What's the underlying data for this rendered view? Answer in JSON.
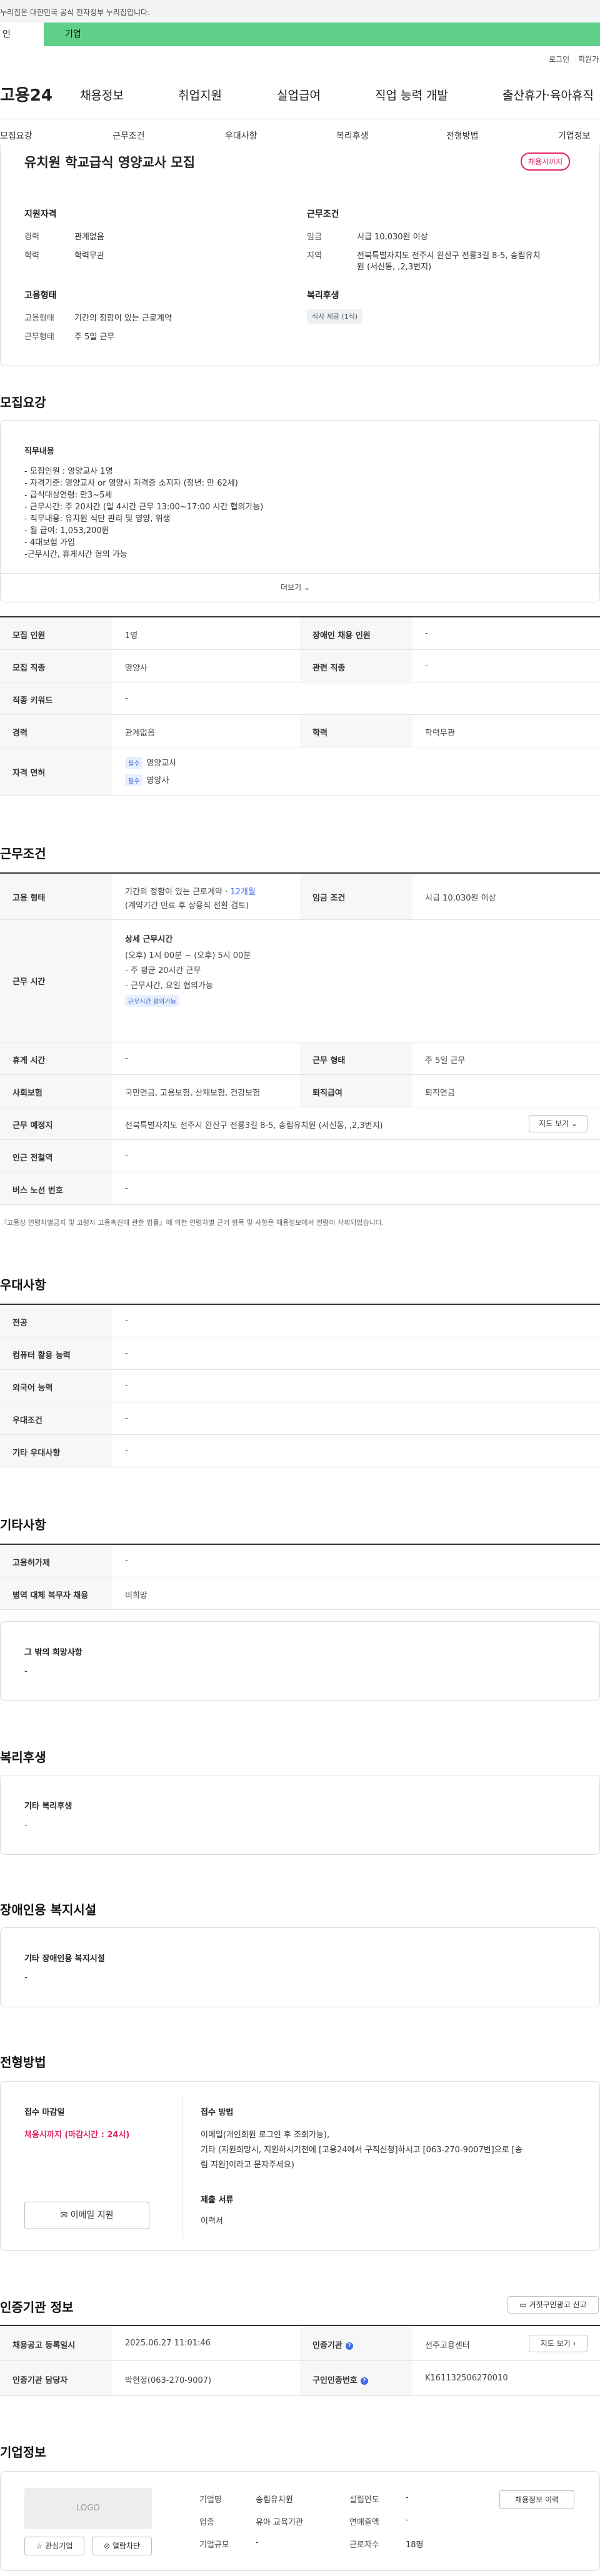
{
  "gov_notice": "누리집은 대한민국 공식 전자정부 누리집입니다.",
  "top_tabs": {
    "active": "인",
    "second": "기업"
  },
  "util": {
    "login": "로그인",
    "join": "회원가"
  },
  "logo": "고용24",
  "gnb": [
    "채용정보",
    "취업지원",
    "실업급여",
    "직업 능력 개발",
    "출산휴가·육아휴직"
  ],
  "subnav": [
    "모집요강",
    "근무조건",
    "우대사항",
    "복리후생",
    "전형방법",
    "기업정보"
  ],
  "header": {
    "title": "유치원 학교급식 영양교사 모집",
    "badge": "채용시까지",
    "qual_title": "지원자격",
    "career_label": "경력",
    "career_value": "관계없음",
    "edu_label": "학력",
    "edu_value": "학력무관",
    "cond_title": "근무조건",
    "wage_label": "임금",
    "wage_value": "시급 10,030원 이상",
    "region_label": "지역",
    "region_value1": "전북특별자치도 전주시 완산구 전룡3길 8-5, 송림유치",
    "region_value2": "원 (서신동, ,2,3번지)",
    "emp_title": "고용형태",
    "emp_label": "고용형태",
    "emp_value": "기간의 정함이 있는 근로계약",
    "worktype_label": "근무형태",
    "worktype_value": "주 5일 근무",
    "welfare_title": "복리후생",
    "welfare_chip": "식사 제공 (1식)"
  },
  "recruit": {
    "section_title": "모집요강",
    "duty_title": "직무내용",
    "duty_lines": [
      "- 모집인원 : 영양교사 1명",
      "- 자격기준: 영양교사 or 영양사 자격증 소지자 (정년: 만 62세)",
      "- 급식대상연령: 만3~5세",
      "- 근무시간: 주 20시간 (일 4시간 근무 13:00~17:00  시간 협의가능)",
      "- 직무내용: 유치원 식단 관리 및 영양, 위생",
      "- 월 급여: 1,053,200원",
      "- 4대보험 가입",
      "-근무시간, 휴게시간 협의 가능"
    ],
    "more": "더보기",
    "rows": {
      "count_label": "모집 인원",
      "count_value": "1명",
      "disabled_label": "장애인 채용 인원",
      "disabled_value": "-",
      "job_label": "모집 직종",
      "job_value": "영양사",
      "related_label": "관련 직종",
      "related_value": "-",
      "keyword_label": "직종 키워드",
      "keyword_value": "-",
      "career_label": "경력",
      "career_value": "관계없음",
      "edu_label": "학력",
      "edu_value": "학력무관",
      "license_label": "자격 면허",
      "licenses": [
        {
          "tag": "필수",
          "name": "영양교사"
        },
        {
          "tag": "필수",
          "name": "영양사"
        }
      ]
    }
  },
  "work": {
    "section_title": "근무조건",
    "emp_label": "고용 형태",
    "emp_value1": "기간의 정함이 있는 근로계약 · ",
    "emp_months": "12개월",
    "emp_value2": "(계약기간 만료 후 상용직 전환 검토)",
    "wage_label": "임금 조건",
    "wage_value": "시급 10,030원 이상",
    "hours_label": "근무 시간",
    "hours_title": "상세 근무시간",
    "hours_lines": [
      "(오후) 1시 00분 ~ (오후) 5시 00분",
      "- 주 평균 20시간 근무",
      "- 근무시간, 요일 협의가능"
    ],
    "hours_chip": "근무시간 협의가능",
    "rest_label": "휴게 시간",
    "rest_value": "-",
    "worktype_label": "근무 형태",
    "worktype_value": "주 5일 근무",
    "insurance_label": "사회보험",
    "insurance_value": "국민연금, 고용보험, 산재보험, 건강보험",
    "retire_label": "퇴직급여",
    "retire_value": "퇴직연금",
    "place_label": "근무 예정지",
    "place_value": "전북특별자치도 전주시 완산구 전룡3길 8-5, 송림유치원 (서신동, ,2,3번지)",
    "map_btn": "지도 보기",
    "subway_label": "인근 전철역",
    "subway_value": "-",
    "bus_label": "버스 노선 번호",
    "bus_value": "-",
    "footnote": "『고용상 연령차별금지 및 고령자 고용촉진에 관한 법률』에 의한 연령차별 근거 항목 및 사항은 채용정보에서 연령이 삭제되었습니다."
  },
  "pref": {
    "section_title": "우대사항",
    "rows": [
      {
        "label": "전공",
        "value": "-"
      },
      {
        "label": "컴퓨터 활용 능력",
        "value": "-"
      },
      {
        "label": "외국어 능력",
        "value": "-"
      },
      {
        "label": "우대조건",
        "value": "-"
      },
      {
        "label": "기타 우대사항",
        "value": "-"
      }
    ]
  },
  "etc": {
    "section_title": "기타사항",
    "rows": [
      {
        "label": "고용허가제",
        "value": "-"
      },
      {
        "label": "병역 대체 복무자 채용",
        "value": "비희망"
      }
    ],
    "other_title": "그 밖의 희망사항",
    "other_value": "-"
  },
  "welfare": {
    "section_title": "복리후생",
    "box_title": "기타 복리후생",
    "box_value": "-"
  },
  "disability": {
    "section_title": "장애인용 복지시설",
    "box_title": "기타 장애인용 복지시설",
    "box_value": "-"
  },
  "selection": {
    "section_title": "전형방법",
    "deadline_label": "접수 마감일",
    "deadline_value": "채용시까지 (마감시간 : 24시)",
    "apply_btn": "이메일 지원",
    "method_label": "접수 방법",
    "method_lines": [
      "이메일(개인회원 로그인 후 조회가능),",
      "기타 (지원희망시, 지원하시기전에 [고용24에서 구직신청]하시고 [063-270-9007번]으로 [송",
      "림 지원]이라고 문자주세요)"
    ],
    "docs_label": "제출 서류",
    "docs_value": "이력서"
  },
  "agency": {
    "section_title": "인증기관 정보",
    "report_btn": "거짓구인광고 신고",
    "reg_label": "채용공고 등록일시",
    "reg_value": "2025.06.27 11:01:46",
    "agency_label": "인증기관",
    "agency_value": "전주고용센터",
    "map_btn": "지도 보기",
    "manager_label": "인증기관 담당자",
    "manager_value": "박현정(063-270-9007)",
    "certno_label": "구인인증번호",
    "certno_value": "K161132506270010"
  },
  "company": {
    "section_title": "기업정보",
    "logo_text": "LOGO",
    "name_label": "기업명",
    "name_value": "송림유치원",
    "year_label": "설립연도",
    "year_value": "-",
    "industry_label": "업종",
    "industry_value": "유아 교육기관",
    "sales_label": "연매출액",
    "sales_value": "-",
    "size_label": "기업규모",
    "size_value": "-",
    "workers_label": "근로자수",
    "workers_value": "18명",
    "jobs_btn": "채용정보 이력",
    "fav_btn": "관심기업",
    "block_btn": "열람차단"
  },
  "colors": {
    "brand_green": "#5fcf8a",
    "badge_red": "#e0245e",
    "link_blue": "#3d6be6"
  }
}
